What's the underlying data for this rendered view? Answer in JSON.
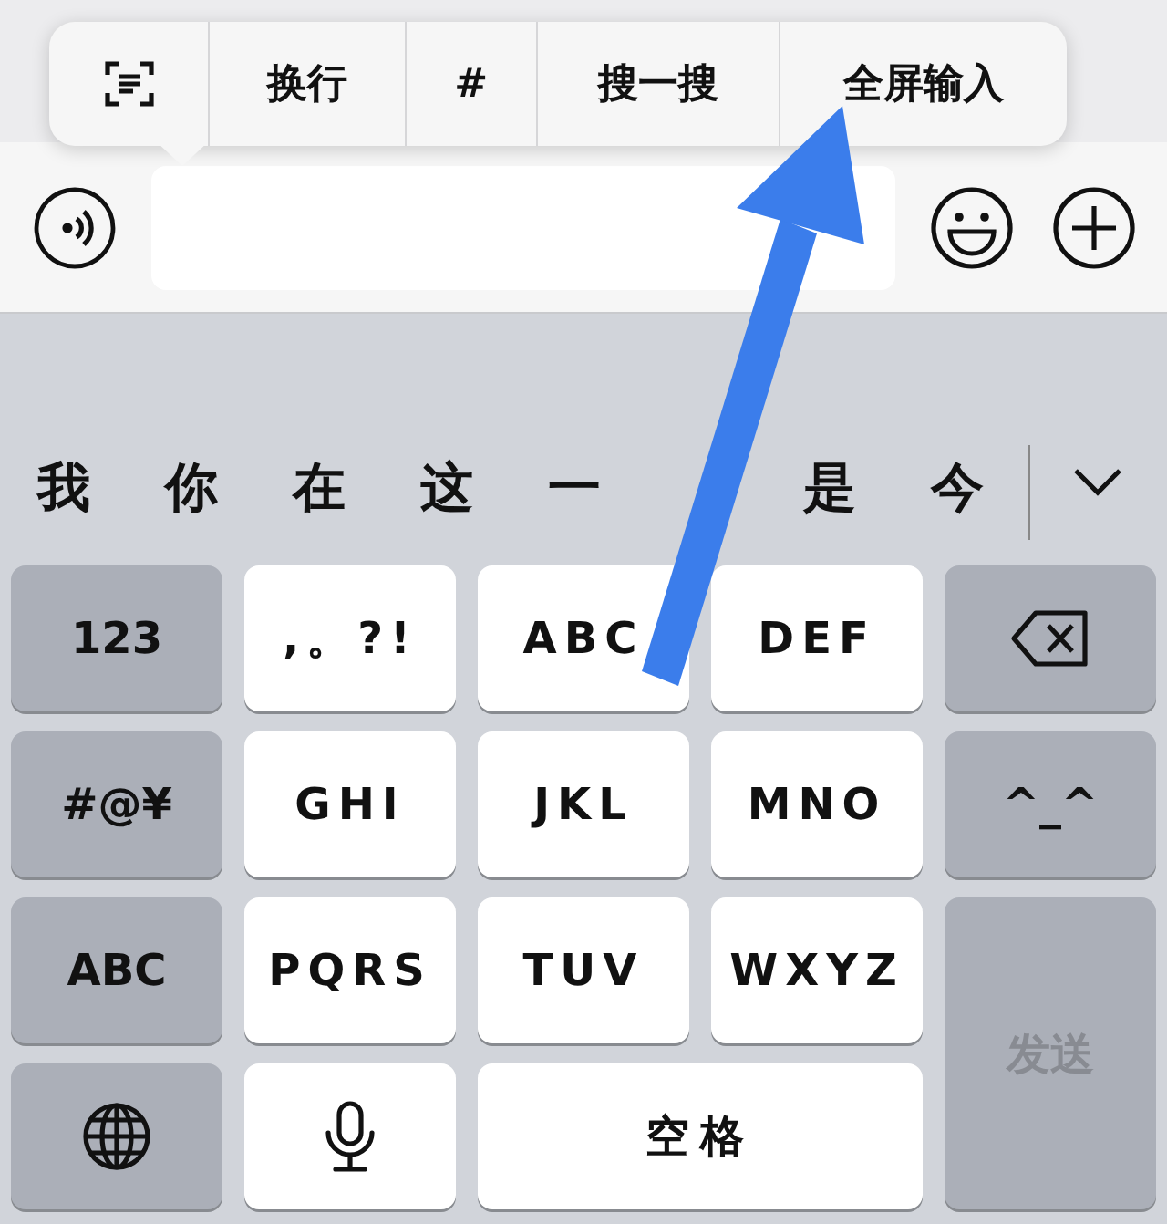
{
  "toolbar_menu": {
    "items": [
      {
        "kind": "icon"
      },
      {
        "kind": "text",
        "label": "换行"
      },
      {
        "kind": "text",
        "label": "#"
      },
      {
        "kind": "text",
        "label": "搜一搜"
      },
      {
        "kind": "text",
        "label": "全屏输入"
      }
    ]
  },
  "candidates": [
    "我",
    "你",
    "在",
    "这",
    "一",
    "是",
    "今"
  ],
  "keys": [
    {
      "kind": "function",
      "label": "123"
    },
    {
      "kind": "letter",
      "label": ",。?!"
    },
    {
      "kind": "letter",
      "label": "ABC"
    },
    {
      "kind": "letter",
      "label": "DEF"
    },
    {
      "kind": "function"
    },
    {
      "kind": "function",
      "label": "#@¥"
    },
    {
      "kind": "letter",
      "label": "GHI"
    },
    {
      "kind": "letter",
      "label": "JKL"
    },
    {
      "kind": "letter",
      "label": "MNO"
    },
    {
      "kind": "function",
      "label": "^_^"
    },
    {
      "kind": "function",
      "label": "ABC"
    },
    {
      "kind": "letter",
      "label": "PQRS"
    },
    {
      "kind": "letter",
      "label": "TUV"
    },
    {
      "kind": "letter",
      "label": "WXYZ"
    },
    {
      "kind": "function"
    },
    {
      "kind": "letter"
    },
    {
      "kind": "space",
      "label": "空格"
    }
  ],
  "send_key": {
    "label": "发送",
    "disabled": true
  }
}
